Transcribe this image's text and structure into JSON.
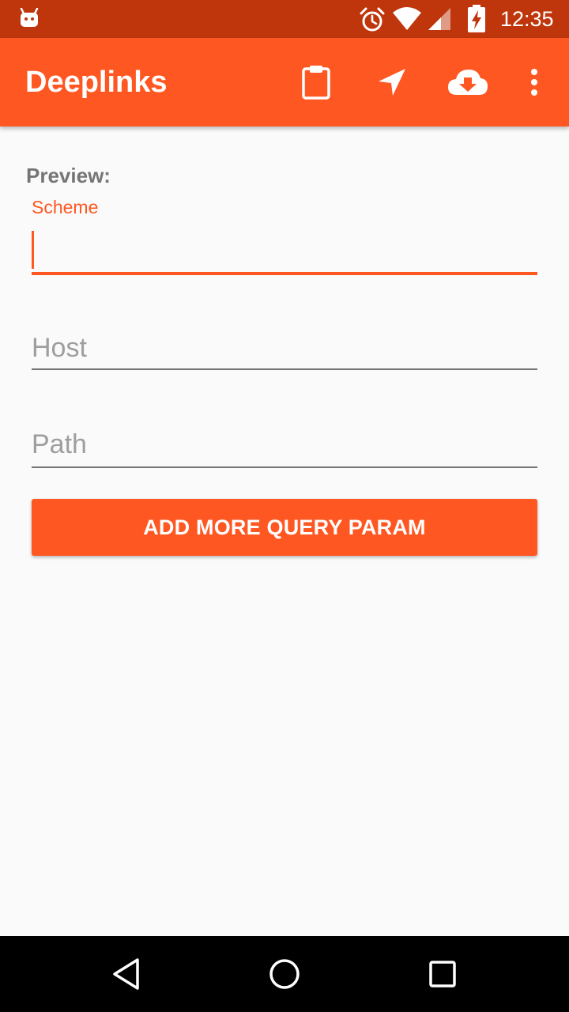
{
  "status_bar": {
    "time": "12:35",
    "background_color": "#bf360c",
    "icons": [
      "android-notification-icon",
      "alarm-icon",
      "wifi-icon",
      "cell-signal-icon",
      "battery-charging-icon"
    ]
  },
  "app_bar": {
    "title": "Deeplinks",
    "background_color": "#ff5722",
    "actions": [
      "clipboard-icon",
      "navigation-arrow-icon",
      "cloud-download-icon",
      "more-vert-icon"
    ]
  },
  "form": {
    "preview_label": "Preview:",
    "scheme": {
      "label": "Scheme",
      "value": ""
    },
    "host": {
      "placeholder": "Host",
      "value": ""
    },
    "path": {
      "placeholder": "Path",
      "value": ""
    },
    "add_button_label": "ADD MORE QUERY PARAM",
    "accent_color": "#ff5722"
  },
  "nav_bar": {
    "buttons": [
      "back-icon",
      "home-icon",
      "recents-icon"
    ]
  }
}
